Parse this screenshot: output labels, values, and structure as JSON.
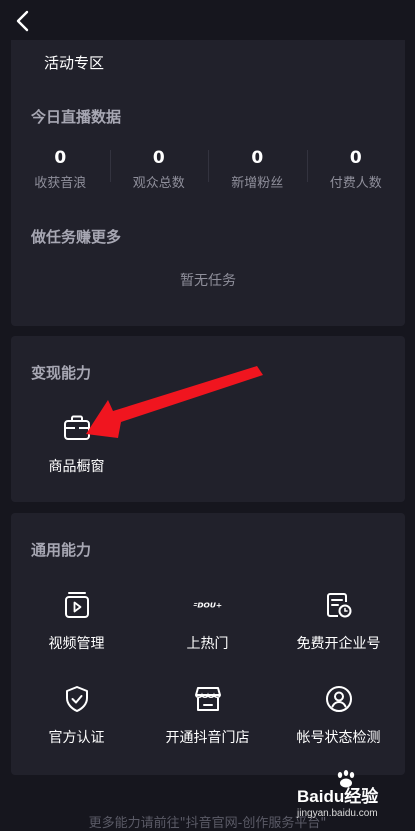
{
  "activity": {
    "label": "活动专区"
  },
  "live_data": {
    "title": "今日直播数据",
    "stats": [
      {
        "value": "0",
        "label": "收获音浪"
      },
      {
        "value": "0",
        "label": "观众总数"
      },
      {
        "value": "0",
        "label": "新增粉丝"
      },
      {
        "value": "0",
        "label": "付费人数"
      }
    ]
  },
  "tasks": {
    "title": "做任务赚更多",
    "empty": "暂无任务"
  },
  "monetize": {
    "title": "变现能力",
    "items": [
      {
        "label": "商品橱窗",
        "icon": "store-window-icon"
      }
    ]
  },
  "general": {
    "title": "通用能力",
    "items": [
      {
        "label": "视频管理",
        "icon": "video-manage-icon"
      },
      {
        "label": "上热门",
        "icon": "dou-plus-icon",
        "logo_text": "DOU+"
      },
      {
        "label": "免费开企业号",
        "icon": "enterprise-account-icon"
      },
      {
        "label": "官方认证",
        "icon": "shield-check-icon"
      },
      {
        "label": "开通抖音门店",
        "icon": "store-icon"
      },
      {
        "label": "帐号状态检测",
        "icon": "account-status-icon"
      }
    ]
  },
  "footer": {
    "note": "更多能力请前往\"抖音官网-创作服务平台\""
  },
  "watermark": {
    "brand": "Baidu经验",
    "url": "jingyan.baidu.com"
  },
  "colors": {
    "background": "#16161e",
    "card": "#21212b",
    "arrow": "#f0151f"
  }
}
